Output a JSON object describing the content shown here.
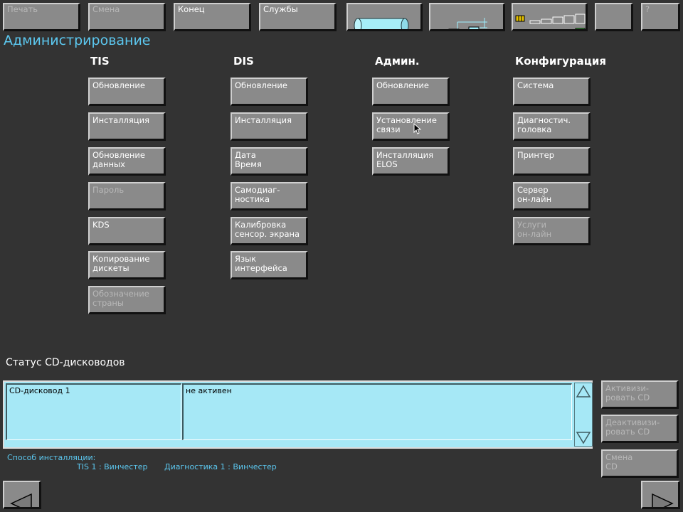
{
  "toolbar": {
    "print_label": "Печать",
    "change_label": "Смена",
    "end_label": "Конец",
    "services_label": "Службы",
    "help_label": "?"
  },
  "page": {
    "title": "Администрирование"
  },
  "columns": {
    "tis": {
      "heading": "TIS",
      "buttons": [
        {
          "label": "Обновление",
          "enabled": true
        },
        {
          "label": "Инсталляция",
          "enabled": true
        },
        {
          "label": "Обновление\nданных",
          "enabled": true
        },
        {
          "label": "Пароль",
          "enabled": false
        },
        {
          "label": "KDS",
          "enabled": true
        },
        {
          "label": "Копирование\nдискеты",
          "enabled": true
        },
        {
          "label": "Обозначение\nстраны",
          "enabled": false
        }
      ]
    },
    "dis": {
      "heading": "DIS",
      "buttons": [
        {
          "label": "Обновление",
          "enabled": true
        },
        {
          "label": "Инсталляция",
          "enabled": true
        },
        {
          "label": "Дата\nВремя",
          "enabled": true
        },
        {
          "label": "Самодиаг-\nностика",
          "enabled": true
        },
        {
          "label": "Калибровка\nсенсор. экрана",
          "enabled": true
        },
        {
          "label": "Язык\nинтерфейса",
          "enabled": true
        }
      ]
    },
    "admin": {
      "heading": "Админ.",
      "buttons": [
        {
          "label": "Обновление",
          "enabled": true
        },
        {
          "label": "Установление\nсвязи",
          "enabled": true
        },
        {
          "label": "Инсталляция\nELOS",
          "enabled": true
        }
      ]
    },
    "config": {
      "heading": "Конфигурация",
      "buttons": [
        {
          "label": "Система",
          "enabled": true
        },
        {
          "label": "Диагностич.\nголовка",
          "enabled": true
        },
        {
          "label": "Принтер",
          "enabled": true
        },
        {
          "label": "Сервер\nон-лайн",
          "enabled": true
        },
        {
          "label": "Услуги\nон-лайн",
          "enabled": false
        }
      ]
    }
  },
  "cd_status": {
    "title": "Статус CD-дисководов",
    "rows": [
      {
        "drive": "CD-дисковод 1",
        "state": "не активен"
      }
    ]
  },
  "side_buttons": {
    "activate_label": "Активизи-\nровать CD",
    "deactivate_label": "Деактивизи-\nровать CD",
    "change_cd_label": "Смена\nCD"
  },
  "install_info": {
    "label": "Способ\nинсталляции:",
    "tis": "TIS 1 : Винчестер",
    "diag": "Диагностика 1 : Винчестер"
  },
  "icons": {
    "cable": "cable-cylinder-icon",
    "network": "network-connection-icon",
    "signal": "signal-status-icon",
    "back": "back-arrow-icon",
    "forward": "forward-arrow-icon",
    "scroll_up": "scroll-up-arrow-icon",
    "scroll_down": "scroll-down-arrow-icon"
  },
  "colors": {
    "background": "#333333",
    "button_face": "#8a8a8a",
    "title_accent": "#5cc8f0",
    "panel_cyan": "#a6e8f6",
    "status_green": "#22dd22",
    "status_red": "#ee1111",
    "status_yellow": "#eedd00"
  }
}
